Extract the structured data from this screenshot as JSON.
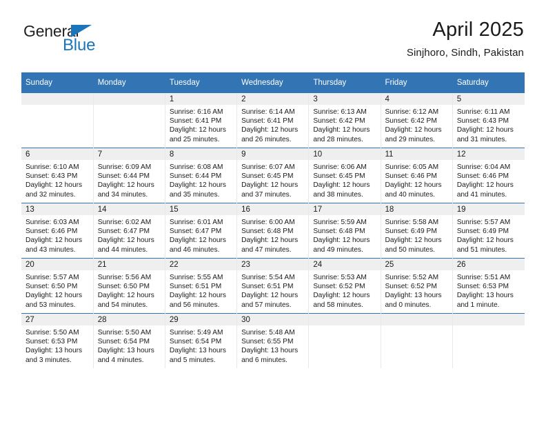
{
  "logo": {
    "word_one": "General",
    "word_two": "Blue",
    "triangle_icon": "triangle-icon",
    "brand_color": "#1b75bb",
    "text_color": "#231f20"
  },
  "header": {
    "title": "April 2025",
    "subtitle": "Sinjhoro, Sindh, Pakistan"
  },
  "theme": {
    "header_blue": "#3274b4",
    "daynum_band": "#efefef",
    "cell_background": "#ffffff"
  },
  "calendar": {
    "weekday_headers": [
      "Sunday",
      "Monday",
      "Tuesday",
      "Wednesday",
      "Thursday",
      "Friday",
      "Saturday"
    ],
    "weeks": [
      [
        {
          "day": "",
          "sunrise": "",
          "sunset": "",
          "daylight_line1": "",
          "daylight_line2": ""
        },
        {
          "day": "",
          "sunrise": "",
          "sunset": "",
          "daylight_line1": "",
          "daylight_line2": ""
        },
        {
          "day": "1",
          "sunrise": "Sunrise: 6:16 AM",
          "sunset": "Sunset: 6:41 PM",
          "daylight_line1": "Daylight: 12 hours",
          "daylight_line2": "and 25 minutes."
        },
        {
          "day": "2",
          "sunrise": "Sunrise: 6:14 AM",
          "sunset": "Sunset: 6:41 PM",
          "daylight_line1": "Daylight: 12 hours",
          "daylight_line2": "and 26 minutes."
        },
        {
          "day": "3",
          "sunrise": "Sunrise: 6:13 AM",
          "sunset": "Sunset: 6:42 PM",
          "daylight_line1": "Daylight: 12 hours",
          "daylight_line2": "and 28 minutes."
        },
        {
          "day": "4",
          "sunrise": "Sunrise: 6:12 AM",
          "sunset": "Sunset: 6:42 PM",
          "daylight_line1": "Daylight: 12 hours",
          "daylight_line2": "and 29 minutes."
        },
        {
          "day": "5",
          "sunrise": "Sunrise: 6:11 AM",
          "sunset": "Sunset: 6:43 PM",
          "daylight_line1": "Daylight: 12 hours",
          "daylight_line2": "and 31 minutes."
        }
      ],
      [
        {
          "day": "6",
          "sunrise": "Sunrise: 6:10 AM",
          "sunset": "Sunset: 6:43 PM",
          "daylight_line1": "Daylight: 12 hours",
          "daylight_line2": "and 32 minutes."
        },
        {
          "day": "7",
          "sunrise": "Sunrise: 6:09 AM",
          "sunset": "Sunset: 6:44 PM",
          "daylight_line1": "Daylight: 12 hours",
          "daylight_line2": "and 34 minutes."
        },
        {
          "day": "8",
          "sunrise": "Sunrise: 6:08 AM",
          "sunset": "Sunset: 6:44 PM",
          "daylight_line1": "Daylight: 12 hours",
          "daylight_line2": "and 35 minutes."
        },
        {
          "day": "9",
          "sunrise": "Sunrise: 6:07 AM",
          "sunset": "Sunset: 6:45 PM",
          "daylight_line1": "Daylight: 12 hours",
          "daylight_line2": "and 37 minutes."
        },
        {
          "day": "10",
          "sunrise": "Sunrise: 6:06 AM",
          "sunset": "Sunset: 6:45 PM",
          "daylight_line1": "Daylight: 12 hours",
          "daylight_line2": "and 38 minutes."
        },
        {
          "day": "11",
          "sunrise": "Sunrise: 6:05 AM",
          "sunset": "Sunset: 6:46 PM",
          "daylight_line1": "Daylight: 12 hours",
          "daylight_line2": "and 40 minutes."
        },
        {
          "day": "12",
          "sunrise": "Sunrise: 6:04 AM",
          "sunset": "Sunset: 6:46 PM",
          "daylight_line1": "Daylight: 12 hours",
          "daylight_line2": "and 41 minutes."
        }
      ],
      [
        {
          "day": "13",
          "sunrise": "Sunrise: 6:03 AM",
          "sunset": "Sunset: 6:46 PM",
          "daylight_line1": "Daylight: 12 hours",
          "daylight_line2": "and 43 minutes."
        },
        {
          "day": "14",
          "sunrise": "Sunrise: 6:02 AM",
          "sunset": "Sunset: 6:47 PM",
          "daylight_line1": "Daylight: 12 hours",
          "daylight_line2": "and 44 minutes."
        },
        {
          "day": "15",
          "sunrise": "Sunrise: 6:01 AM",
          "sunset": "Sunset: 6:47 PM",
          "daylight_line1": "Daylight: 12 hours",
          "daylight_line2": "and 46 minutes."
        },
        {
          "day": "16",
          "sunrise": "Sunrise: 6:00 AM",
          "sunset": "Sunset: 6:48 PM",
          "daylight_line1": "Daylight: 12 hours",
          "daylight_line2": "and 47 minutes."
        },
        {
          "day": "17",
          "sunrise": "Sunrise: 5:59 AM",
          "sunset": "Sunset: 6:48 PM",
          "daylight_line1": "Daylight: 12 hours",
          "daylight_line2": "and 49 minutes."
        },
        {
          "day": "18",
          "sunrise": "Sunrise: 5:58 AM",
          "sunset": "Sunset: 6:49 PM",
          "daylight_line1": "Daylight: 12 hours",
          "daylight_line2": "and 50 minutes."
        },
        {
          "day": "19",
          "sunrise": "Sunrise: 5:57 AM",
          "sunset": "Sunset: 6:49 PM",
          "daylight_line1": "Daylight: 12 hours",
          "daylight_line2": "and 51 minutes."
        }
      ],
      [
        {
          "day": "20",
          "sunrise": "Sunrise: 5:57 AM",
          "sunset": "Sunset: 6:50 PM",
          "daylight_line1": "Daylight: 12 hours",
          "daylight_line2": "and 53 minutes."
        },
        {
          "day": "21",
          "sunrise": "Sunrise: 5:56 AM",
          "sunset": "Sunset: 6:50 PM",
          "daylight_line1": "Daylight: 12 hours",
          "daylight_line2": "and 54 minutes."
        },
        {
          "day": "22",
          "sunrise": "Sunrise: 5:55 AM",
          "sunset": "Sunset: 6:51 PM",
          "daylight_line1": "Daylight: 12 hours",
          "daylight_line2": "and 56 minutes."
        },
        {
          "day": "23",
          "sunrise": "Sunrise: 5:54 AM",
          "sunset": "Sunset: 6:51 PM",
          "daylight_line1": "Daylight: 12 hours",
          "daylight_line2": "and 57 minutes."
        },
        {
          "day": "24",
          "sunrise": "Sunrise: 5:53 AM",
          "sunset": "Sunset: 6:52 PM",
          "daylight_line1": "Daylight: 12 hours",
          "daylight_line2": "and 58 minutes."
        },
        {
          "day": "25",
          "sunrise": "Sunrise: 5:52 AM",
          "sunset": "Sunset: 6:52 PM",
          "daylight_line1": "Daylight: 13 hours",
          "daylight_line2": "and 0 minutes."
        },
        {
          "day": "26",
          "sunrise": "Sunrise: 5:51 AM",
          "sunset": "Sunset: 6:53 PM",
          "daylight_line1": "Daylight: 13 hours",
          "daylight_line2": "and 1 minute."
        }
      ],
      [
        {
          "day": "27",
          "sunrise": "Sunrise: 5:50 AM",
          "sunset": "Sunset: 6:53 PM",
          "daylight_line1": "Daylight: 13 hours",
          "daylight_line2": "and 3 minutes."
        },
        {
          "day": "28",
          "sunrise": "Sunrise: 5:50 AM",
          "sunset": "Sunset: 6:54 PM",
          "daylight_line1": "Daylight: 13 hours",
          "daylight_line2": "and 4 minutes."
        },
        {
          "day": "29",
          "sunrise": "Sunrise: 5:49 AM",
          "sunset": "Sunset: 6:54 PM",
          "daylight_line1": "Daylight: 13 hours",
          "daylight_line2": "and 5 minutes."
        },
        {
          "day": "30",
          "sunrise": "Sunrise: 5:48 AM",
          "sunset": "Sunset: 6:55 PM",
          "daylight_line1": "Daylight: 13 hours",
          "daylight_line2": "and 6 minutes."
        },
        {
          "day": "",
          "sunrise": "",
          "sunset": "",
          "daylight_line1": "",
          "daylight_line2": ""
        },
        {
          "day": "",
          "sunrise": "",
          "sunset": "",
          "daylight_line1": "",
          "daylight_line2": ""
        },
        {
          "day": "",
          "sunrise": "",
          "sunset": "",
          "daylight_line1": "",
          "daylight_line2": ""
        }
      ]
    ]
  }
}
